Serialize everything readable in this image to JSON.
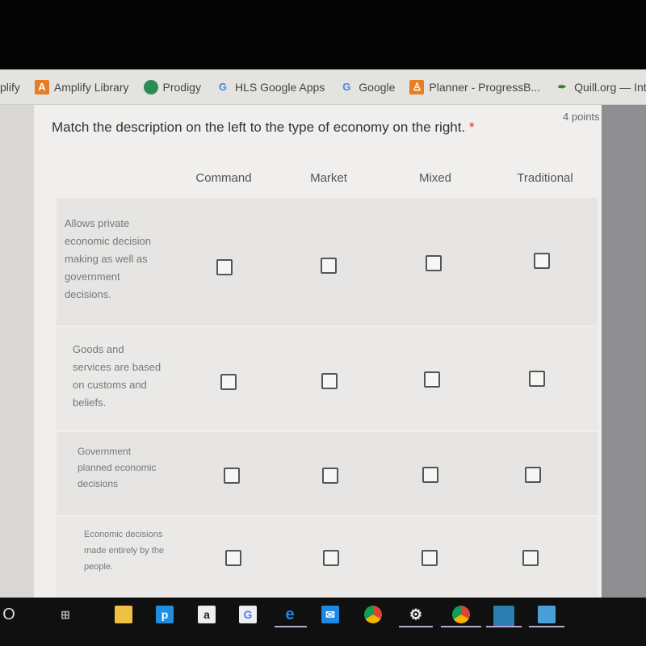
{
  "bookmarks": [
    {
      "label": "plify",
      "icon": "amplify-icon"
    },
    {
      "label": "Amplify Library",
      "icon": "amplify-library-icon",
      "color": "#e67e22"
    },
    {
      "label": "Prodigy",
      "icon": "prodigy-icon",
      "color": "#2e8b57"
    },
    {
      "label": "HLS Google Apps",
      "icon": "google-icon"
    },
    {
      "label": "Google",
      "icon": "google-icon"
    },
    {
      "label": "Planner - ProgressB...",
      "icon": "planner-icon",
      "color": "#e67e22"
    },
    {
      "label": "Quill.org — Inte",
      "icon": "quill-icon",
      "color": "#2e7d32"
    }
  ],
  "question": {
    "text": "Match the description on the left to the type of economy on the right.",
    "required_mark": "*",
    "points": "4 points"
  },
  "columns": [
    "Command",
    "Market",
    "Mixed",
    "Traditional"
  ],
  "rows": [
    {
      "label": "Allows private economic decision making as well as government decisions.",
      "checked": [
        false,
        false,
        false,
        false
      ]
    },
    {
      "label": "Goods and services are based on customs and beliefs.",
      "checked": [
        false,
        false,
        false,
        false
      ]
    },
    {
      "label": "Government planned economic decisions",
      "checked": [
        false,
        false,
        false,
        false
      ]
    },
    {
      "label": "Economic decisions made entirely by the people.",
      "checked": [
        false,
        false,
        false,
        false
      ]
    }
  ],
  "taskbar": {
    "items": [
      "cortana-icon",
      "task-view-icon",
      "file-explorer-icon",
      "pandora-icon",
      "amazon-icon",
      "google-icon",
      "edge-icon",
      "mail-icon",
      "chrome-icon",
      "settings-icon",
      "chrome-user-icon",
      "app-icon",
      "app-icon-2"
    ],
    "labels": {
      "pandora": "p",
      "amazon": "a",
      "google": "G",
      "edge": "e"
    }
  }
}
